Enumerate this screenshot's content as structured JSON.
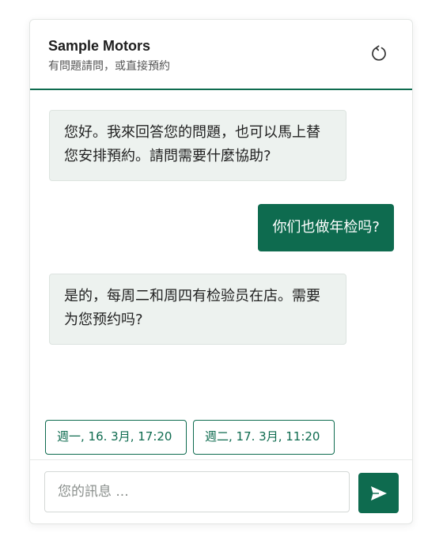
{
  "header": {
    "title": "Sample Motors",
    "subtitle": "有問題請問，或直接預約",
    "refresh_icon": "refresh-icon"
  },
  "messages": [
    {
      "sender": "bot",
      "text": "您好。我來回答您的問題，也可以馬上替您安排預約。請問需要什麼協助?"
    },
    {
      "sender": "user",
      "text": "你们也做年检吗?"
    },
    {
      "sender": "bot",
      "text": "是的，每周二和周四有检验员在店。需要为您预约吗?"
    }
  ],
  "quick_replies": [
    {
      "label": "週一, 16. 3月, 17:20"
    },
    {
      "label": "週二, 17. 3月, 11:20"
    }
  ],
  "composer": {
    "placeholder": "您的訊息 ...",
    "value": "",
    "send_icon": "send-icon"
  },
  "colors": {
    "accent": "#0e6b4f",
    "bot_bubble": "#edf2ef",
    "user_text": "#ffffff"
  }
}
